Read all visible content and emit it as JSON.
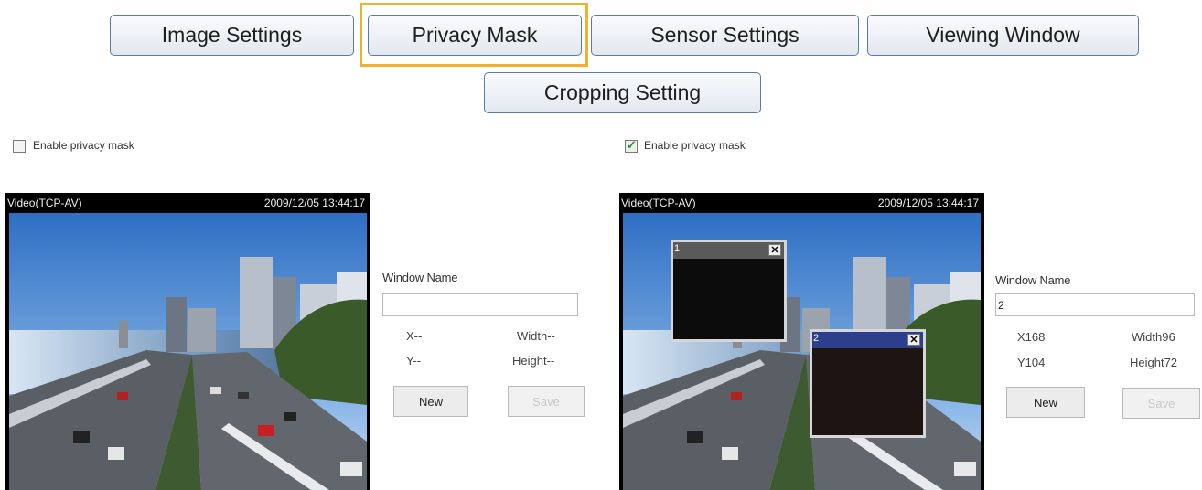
{
  "tabs": [
    {
      "label": "Image Settings"
    },
    {
      "label": "Privacy Mask",
      "active": true
    },
    {
      "label": "Sensor Settings"
    },
    {
      "label": "Viewing Window"
    },
    {
      "label": "Cropping Setting"
    }
  ],
  "left_panel": {
    "enable_label": "Enable privacy mask",
    "enable_checked": false,
    "video_title": "Video(TCP-AV)",
    "video_datetime": "2009/12/05 13:44:17",
    "window_name_label": "Window Name",
    "window_name_value": "",
    "x_label": "X--",
    "y_label": "Y--",
    "width_label": "Width--",
    "height_label": "Height--",
    "new_label": "New",
    "save_label": "Save"
  },
  "right_panel": {
    "enable_label": "Enable privacy mask",
    "enable_checked": true,
    "video_title": "Video(TCP-AV)",
    "video_datetime": "2009/12/05 13:44:17",
    "window_name_label": "Window Name",
    "window_name_value": "2",
    "x_label": "X168",
    "y_label": "Y104",
    "width_label": "Width96",
    "height_label": "Height72",
    "new_label": "New",
    "save_label": "Save",
    "masks": [
      {
        "name": "1",
        "close": "✕",
        "header_color": "#5a5a5a"
      },
      {
        "name": "2",
        "close": "✕",
        "header_color": "#2b3f8c"
      }
    ]
  },
  "colors": {
    "accent": "#f0b030",
    "tab_border": "#5a7aa8"
  }
}
